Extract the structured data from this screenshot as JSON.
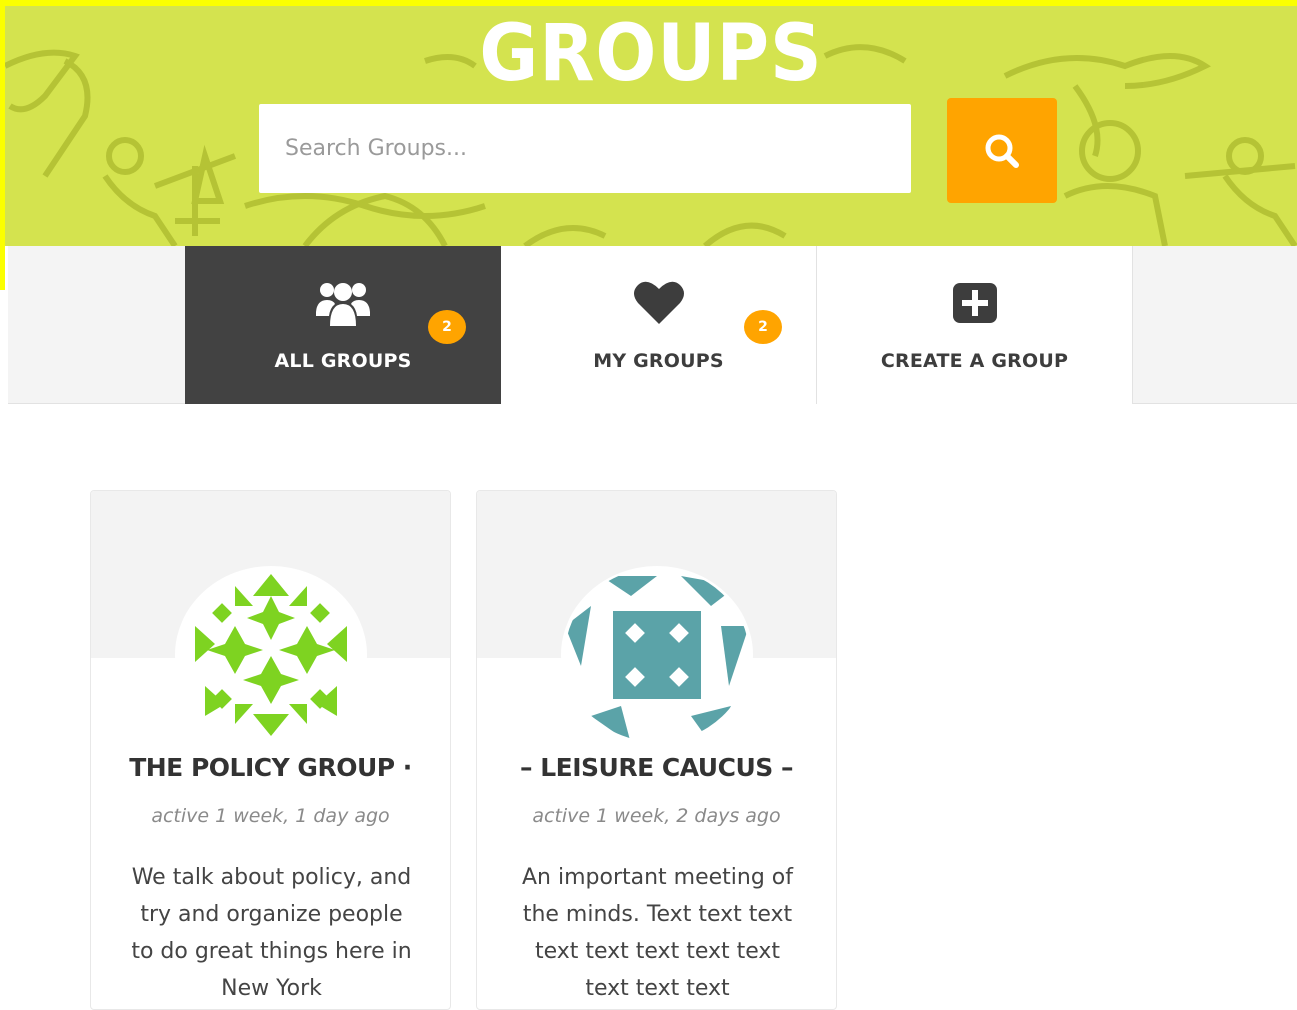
{
  "hero": {
    "title": "GROUPS",
    "search_placeholder": "Search Groups...",
    "search_icon": "search-icon",
    "background_color": "#d4e34f",
    "button_color": "#ffa400"
  },
  "tabs": [
    {
      "label": "ALL GROUPS",
      "icon": "users-icon",
      "badge": "2",
      "active": true
    },
    {
      "label": "MY GROUPS",
      "icon": "heart-icon",
      "badge": "2",
      "active": false
    },
    {
      "label": "CREATE A GROUP",
      "icon": "plus-square-icon",
      "active": false
    }
  ],
  "groups": [
    {
      "title": "THE POLICY GROUP ·",
      "activity": "active 1 week, 1 day ago",
      "description": "We talk about policy, and try and organize people to do great things here in New York",
      "avatar_color": "#7ed321"
    },
    {
      "title": "– LEISURE CAUCUS –",
      "activity": "active 1 week, 2 days ago",
      "description": "An important meeting of the minds. Text text text text text text text text text text text",
      "avatar_color": "#5ba3a8"
    }
  ]
}
